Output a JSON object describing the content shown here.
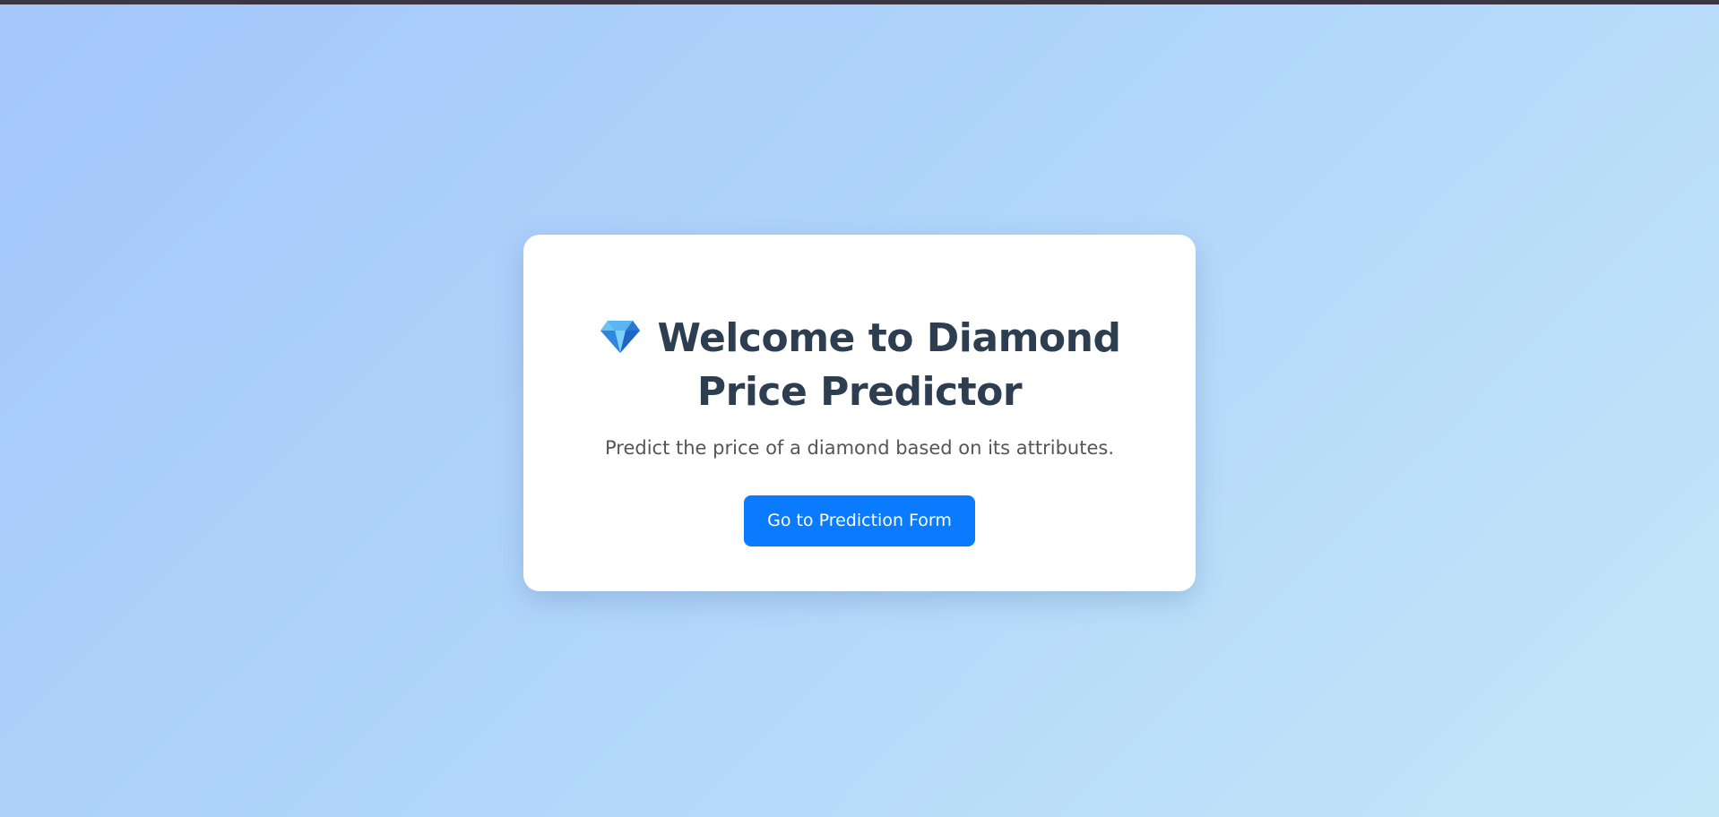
{
  "hero": {
    "icon": "gem-icon",
    "title_line1": "Welcome to Diamond",
    "title_line2": "Price Predictor",
    "subtitle": "Predict the price of a diamond based on its attributes.",
    "cta_label": "Go to Prediction Form"
  },
  "colors": {
    "accent": "#0a7bff",
    "heading": "#2c3e50",
    "text": "#555555",
    "card": "#ffffff"
  }
}
